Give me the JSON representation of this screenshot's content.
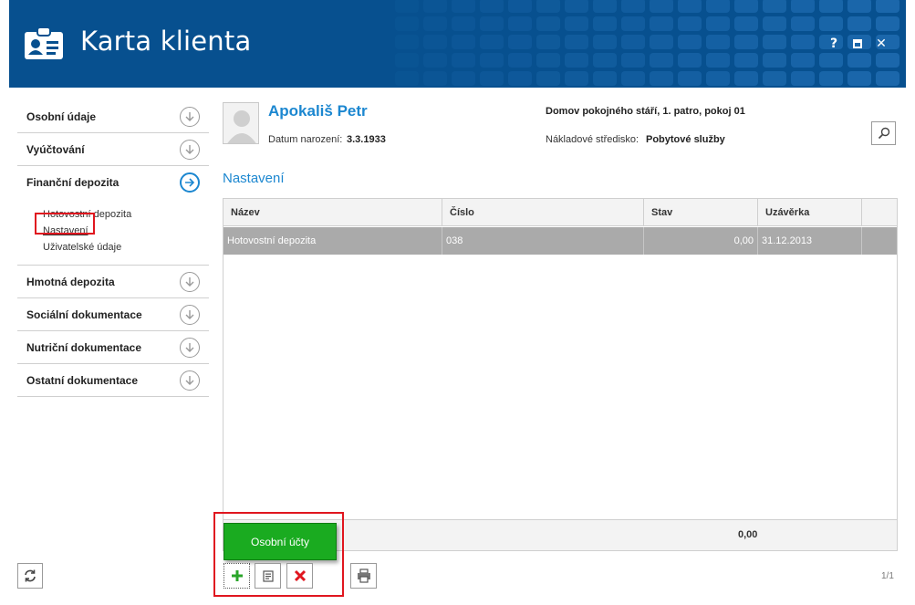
{
  "window": {
    "title": "Karta klienta",
    "help_label": "?",
    "close_label": "✕"
  },
  "sidebar": {
    "items": [
      {
        "label": "Osobní údaje"
      },
      {
        "label": "Vyúčtování"
      },
      {
        "label": "Finanční depozita",
        "active": true
      },
      {
        "label": "Hmotná depozita"
      },
      {
        "label": "Sociální dokumentace"
      },
      {
        "label": "Nutriční dokumentace"
      },
      {
        "label": "Ostatní dokumentace"
      }
    ],
    "sub_items": [
      {
        "label": "Hotovostní depozita"
      },
      {
        "label": "Nastavení",
        "selected": true
      },
      {
        "label": "Uživatelské údaje"
      }
    ]
  },
  "client": {
    "name": "Apokališ Petr",
    "dob_label": "Datum narození:",
    "dob_value": "3.3.1933",
    "address": "Domov pokojného stáří, 1. patro, pokoj 01",
    "cost_center_label": "Nákladové středisko:",
    "cost_center_value": "Pobytové služby"
  },
  "section": {
    "title": "Nastavení"
  },
  "table": {
    "columns": [
      "Název",
      "Číslo",
      "Stav",
      "Uzávěrka"
    ],
    "rows": [
      {
        "nazev": "Hotovostní depozita",
        "cislo": "038",
        "stav": "0,00",
        "uzaverka": "31.12.2013"
      }
    ],
    "footer_total": "0,00"
  },
  "actions": {
    "popup_label": "Osobní účty",
    "add_icon": "plus-icon",
    "edit_icon": "edit-icon",
    "delete_icon": "delete-icon",
    "print_icon": "print-icon",
    "refresh_icon": "refresh-icon"
  },
  "pager": {
    "text": "1/1"
  },
  "colors": {
    "header_bg": "#07508f",
    "accent": "#1c87d0",
    "selected_row": "#aaaaaa",
    "popup_green": "#1aab20",
    "highlight_red": "#e0161f"
  }
}
